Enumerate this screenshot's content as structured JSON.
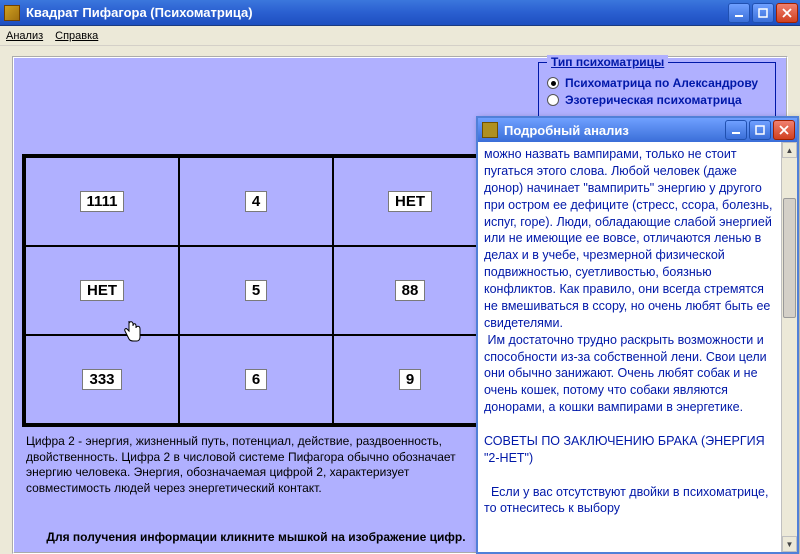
{
  "window": {
    "title": "Квадрат Пифагора (Психоматрица)"
  },
  "menu": {
    "analysis": "Анализ",
    "help": "Справка"
  },
  "typeGroup": {
    "legend": "Тип психоматрицы",
    "options": [
      {
        "label": "Психоматрица по Александрову",
        "checked": true
      },
      {
        "label": "Эзотерическая психоматрица",
        "checked": false
      }
    ]
  },
  "grid": {
    "cells": [
      [
        "1111",
        "4",
        "НЕТ"
      ],
      [
        "НЕТ",
        "5",
        "88"
      ],
      [
        "333",
        "6",
        "9"
      ]
    ]
  },
  "summary": "Цифра 2 - энергия, жизненный путь, потенциал, действие, раздвоенность, двойственность. Цифра 2 в числовой системе Пифагора обычно обозначает энергию человека. Энергия, обозначаемая цифрой 2, характеризует совместимость людей через энергетический контакт.",
  "hint": "Для получения информации кликните мышкой на изображение цифр.",
  "child": {
    "title": "Подробный анализ",
    "body": "можно назвать вампирами, только не стоит пугаться этого слова. Любой человек (даже донор) начинает \"вампирить\" энергию у другого при остром ее дефиците (стресс, ссора, болезнь, испуг, горе). Люди, обладающие слабой энергией или не имеющие ее вовсе, отличаются ленью в делах и в учебе, чрезмерной физической подвижностью, суетливостью, боязнью конфликтов. Как правило, они всегда стремятся не вмешиваться в ссору, но очень любят быть ее свидетелями.\n Им достаточно трудно раскрыть возможности и способности из-за собственной лени. Свои цели они обычно занижают. Очень любят собак и не очень кошек, потому что собаки являются донорами, а кошки вампирами в энергетике.\n\nСОВЕТЫ ПО ЗАКЛЮЧЕНИЮ БРАКА (ЭНЕРГИЯ \"2-НЕТ\")\n\n  Если у вас отсутствуют двойки в психоматрице, то отнеситесь к выбору"
  }
}
